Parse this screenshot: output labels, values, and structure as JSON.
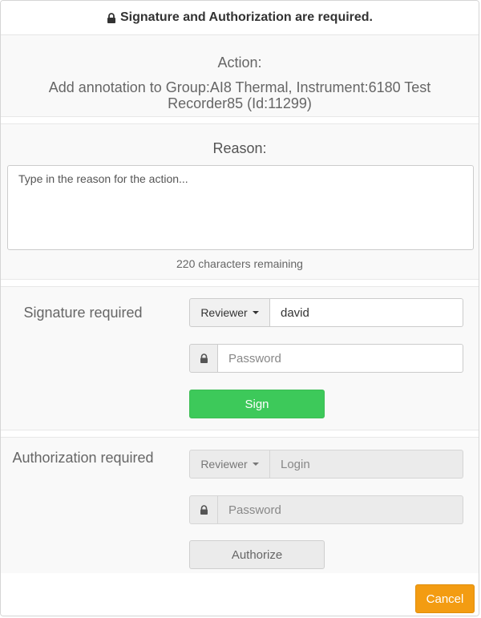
{
  "header": {
    "title": "Signature and Authorization are required."
  },
  "action": {
    "label": "Action:",
    "text": "Add annotation to Group:AI8 Thermal, Instrument:6180 Test Recorder85 (Id:11299)"
  },
  "reason": {
    "label": "Reason:",
    "placeholder": "Type in the reason for the action...",
    "remaining": "220 characters remaining"
  },
  "signature": {
    "label": "Signature required",
    "role_button": "Reviewer",
    "username": "david",
    "password_placeholder": "Password",
    "sign_label": "Sign"
  },
  "authorization": {
    "label": "Authorization required",
    "role_button": "Reviewer",
    "login_placeholder": "Login",
    "password_placeholder": "Password",
    "authorize_label": "Authorize"
  },
  "footer": {
    "cancel_label": "Cancel"
  },
  "colors": {
    "sign": "#3dc95a",
    "cancel": "#f39c12"
  }
}
